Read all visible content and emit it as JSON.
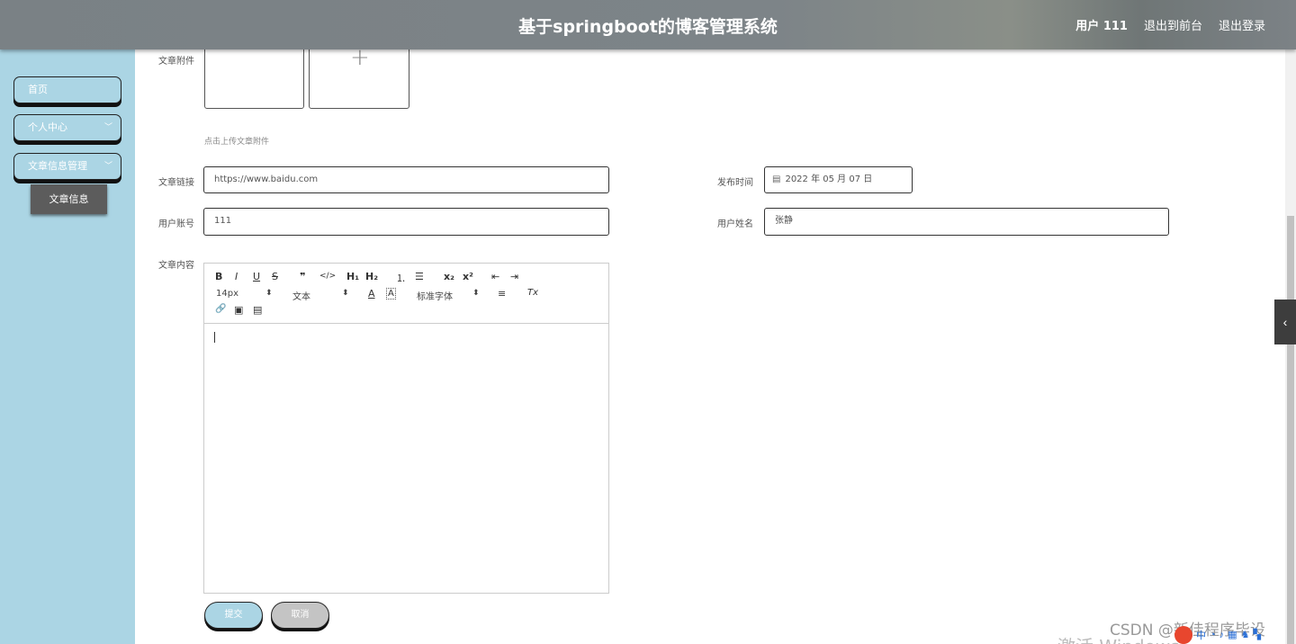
{
  "header": {
    "title": "基于springboot的博客管理系统",
    "user": "用户 111",
    "exit_front": "退出到前台",
    "logout": "退出登录"
  },
  "sidebar": {
    "items": [
      {
        "label": "首页"
      },
      {
        "label": "个人中心"
      },
      {
        "label": "文章信息管理"
      }
    ],
    "submenu": {
      "label": "文章信息"
    }
  },
  "form": {
    "attachment_label": "文章附件",
    "upload_plus": "+",
    "upload_hint": "点击上传文章附件",
    "link_label": "文章链接",
    "link_value": "https://www.baidu.com",
    "publish_label": "发布时间",
    "publish_value": "2022 年 05 月 07 日",
    "account_label": "用户账号",
    "account_value": "111",
    "name_label": "用户姓名",
    "name_value": "张静",
    "content_label": "文章内容"
  },
  "editor": {
    "bold": "B",
    "italic": "I",
    "underline": "U",
    "strike": "S",
    "quote": "❞",
    "code": "</>",
    "h1": "H₁",
    "h2": "H₂",
    "ordered": "⒈",
    "bullet": "☰",
    "sub": "x₂",
    "sup": "x²",
    "outdent": "⇤",
    "indent": "⇥",
    "size_select": "14px",
    "type_select": "文本",
    "color": "A",
    "bg": "A",
    "font_select": "标准字体",
    "align": "≡",
    "clear": "Tx",
    "link": "🔗",
    "image": "▣",
    "video": "▤",
    "select_arrow": "⬍"
  },
  "buttons": {
    "submit": "提交",
    "cancel": "取消"
  },
  "side_toggle": "‹",
  "watermark": "CSDN @新佳程序毕设",
  "win_watermark": "激活 Windows"
}
